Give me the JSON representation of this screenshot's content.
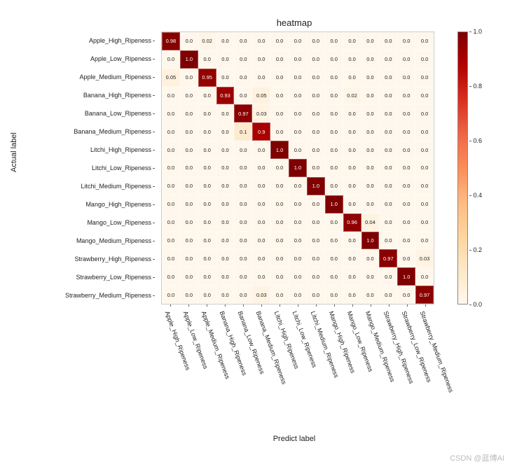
{
  "chart_data": {
    "type": "heatmap",
    "title": "heatmap",
    "xlabel": "Predict label",
    "ylabel": "Actual label",
    "labels": [
      "Apple_High_Ripeness",
      "Apple_Low_Ripeness",
      "Apple_Medium_Ripeness",
      "Banana_High_Ripeness",
      "Banana_Low_Ripeness",
      "Banana_Medium_Ripeness",
      "Litchi_High_Ripeness",
      "Litchi_Low_Ripeness",
      "Litchi_Medium_Ripeness",
      "Mango_High_Ripeness",
      "Mango_Low_Ripeness",
      "Mango_Medium_Ripeness",
      "Strawberry_High_Ripeness",
      "Strawberry_Low_Ripeness",
      "Strawberry_Medium_Ripeness"
    ],
    "matrix": [
      [
        0.98,
        0.0,
        0.02,
        0.0,
        0.0,
        0.0,
        0.0,
        0.0,
        0.0,
        0.0,
        0.0,
        0.0,
        0.0,
        0.0,
        0.0
      ],
      [
        0.0,
        1.0,
        0.0,
        0.0,
        0.0,
        0.0,
        0.0,
        0.0,
        0.0,
        0.0,
        0.0,
        0.0,
        0.0,
        0.0,
        0.0
      ],
      [
        0.05,
        0.0,
        0.95,
        0.0,
        0.0,
        0.0,
        0.0,
        0.0,
        0.0,
        0.0,
        0.0,
        0.0,
        0.0,
        0.0,
        0.0
      ],
      [
        0.0,
        0.0,
        0.0,
        0.93,
        0.0,
        0.05,
        0.0,
        0.0,
        0.0,
        0.0,
        0.02,
        0.0,
        0.0,
        0.0,
        0.0
      ],
      [
        0.0,
        0.0,
        0.0,
        0.0,
        0.97,
        0.03,
        0.0,
        0.0,
        0.0,
        0.0,
        0.0,
        0.0,
        0.0,
        0.0,
        0.0
      ],
      [
        0.0,
        0.0,
        0.0,
        0.0,
        0.1,
        0.9,
        0.0,
        0.0,
        0.0,
        0.0,
        0.0,
        0.0,
        0.0,
        0.0,
        0.0
      ],
      [
        0.0,
        0.0,
        0.0,
        0.0,
        0.0,
        0.0,
        1.0,
        0.0,
        0.0,
        0.0,
        0.0,
        0.0,
        0.0,
        0.0,
        0.0
      ],
      [
        0.0,
        0.0,
        0.0,
        0.0,
        0.0,
        0.0,
        0.0,
        1.0,
        0.0,
        0.0,
        0.0,
        0.0,
        0.0,
        0.0,
        0.0
      ],
      [
        0.0,
        0.0,
        0.0,
        0.0,
        0.0,
        0.0,
        0.0,
        0.0,
        1.0,
        0.0,
        0.0,
        0.0,
        0.0,
        0.0,
        0.0
      ],
      [
        0.0,
        0.0,
        0.0,
        0.0,
        0.0,
        0.0,
        0.0,
        0.0,
        0.0,
        1.0,
        0.0,
        0.0,
        0.0,
        0.0,
        0.0
      ],
      [
        0.0,
        0.0,
        0.0,
        0.0,
        0.0,
        0.0,
        0.0,
        0.0,
        0.0,
        0.0,
        0.96,
        0.04,
        0.0,
        0.0,
        0.0
      ],
      [
        0.0,
        0.0,
        0.0,
        0.0,
        0.0,
        0.0,
        0.0,
        0.0,
        0.0,
        0.0,
        0.0,
        1.0,
        0.0,
        0.0,
        0.0
      ],
      [
        0.0,
        0.0,
        0.0,
        0.0,
        0.0,
        0.0,
        0.0,
        0.0,
        0.0,
        0.0,
        0.0,
        0.0,
        0.97,
        0.0,
        0.03
      ],
      [
        0.0,
        0.0,
        0.0,
        0.0,
        0.0,
        0.0,
        0.0,
        0.0,
        0.0,
        0.0,
        0.0,
        0.0,
        0.0,
        1.0,
        0.0
      ],
      [
        0.0,
        0.0,
        0.0,
        0.0,
        0.0,
        0.03,
        0.0,
        0.0,
        0.0,
        0.0,
        0.0,
        0.0,
        0.0,
        0.0,
        0.97
      ]
    ],
    "colormap": "OrRd",
    "vmin": 0.0,
    "vmax": 1.0,
    "cbar_ticks": [
      0.0,
      0.2,
      0.4,
      0.6,
      0.8,
      1.0
    ]
  },
  "watermark": "CSDN @蓝博AI"
}
